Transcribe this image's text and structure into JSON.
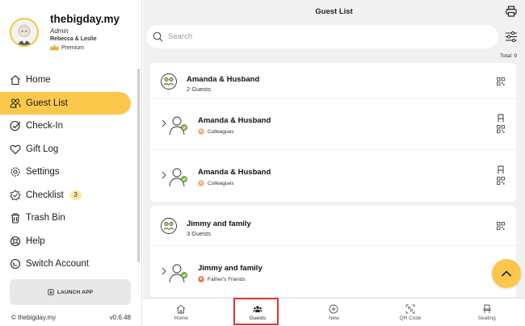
{
  "profile": {
    "app_name": "thebigday.my",
    "role": "Admin",
    "couple": "Rebecca & Leslie",
    "plan": "Premium"
  },
  "nav": [
    {
      "label": "Home",
      "icon": "home-icon"
    },
    {
      "label": "Guest List",
      "icon": "guests-icon",
      "active": true
    },
    {
      "label": "Check-In",
      "icon": "check-in-icon"
    },
    {
      "label": "Gift Log",
      "icon": "heart-icon"
    },
    {
      "label": "Settings",
      "icon": "gear-icon"
    },
    {
      "label": "Checklist",
      "icon": "checklist-icon",
      "badge": "3"
    },
    {
      "label": "Trash Bin",
      "icon": "trash-icon"
    },
    {
      "label": "Help",
      "icon": "help-icon"
    },
    {
      "label": "Switch Account",
      "icon": "switch-icon"
    }
  ],
  "launch_label": "LAUNCH APP",
  "footer": {
    "copyright": "© thebigday.my",
    "version": "v0.6.48"
  },
  "header": {
    "title": "Guest List"
  },
  "search": {
    "placeholder": "Search"
  },
  "total": "Total: 9",
  "groups": [
    {
      "name": "Amanda & Husband",
      "count": "2 Guests",
      "members": [
        {
          "name": "Amanda & Husband",
          "tag": "Colleagues"
        },
        {
          "name": "Amanda & Husband",
          "tag": "Colleagues"
        }
      ]
    },
    {
      "name": "Jimmy and family",
      "count": "3 Guests",
      "members": [
        {
          "name": "Jimmy and family",
          "tag": "Father's Friends"
        }
      ]
    }
  ],
  "tabs": [
    {
      "label": "Home",
      "icon": "home-icon"
    },
    {
      "label": "Guests",
      "icon": "guests-icon",
      "active": true
    },
    {
      "label": "New",
      "icon": "plus-circle-icon"
    },
    {
      "label": "QR Code",
      "icon": "qr-scan-icon"
    },
    {
      "label": "Seating",
      "icon": "chair-icon"
    }
  ],
  "colors": {
    "accent": "#fcc84b",
    "highlight": "#e03232",
    "badge_bg": "#fde7a5"
  }
}
